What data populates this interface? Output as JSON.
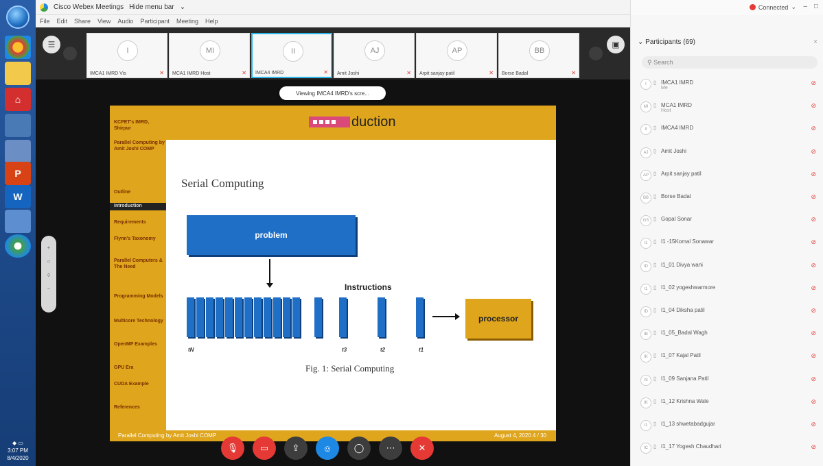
{
  "window": {
    "title": "Cisco Webex Meetings",
    "hide_menu": "Hide menu bar",
    "menu": [
      "File",
      "Edit",
      "Share",
      "View",
      "Audio",
      "Participant",
      "Meeting",
      "Help"
    ]
  },
  "thumbnails": [
    {
      "initials": "I",
      "name": "IMCA1 IMRD Vis"
    },
    {
      "initials": "MI",
      "name": "MCA1 IMRD Host"
    },
    {
      "initials": "II",
      "name": "IMCA4 IMRD"
    },
    {
      "initials": "AJ",
      "name": "Amit Joshi"
    },
    {
      "initials": "AP",
      "name": "Arpit sanjay patil"
    },
    {
      "initials": "BB",
      "name": "Borse Badal"
    }
  ],
  "viewing_banner": "Viewing IMCA4 IMRD's scre...",
  "slide": {
    "title": "duction",
    "side_items": [
      {
        "label": "KCPET's IMRD, Shirpur"
      },
      {
        "label": "Parallel Computing by Amit Joshi COMP"
      },
      {
        "label": "Outline"
      },
      {
        "label": "Introduction"
      },
      {
        "label": "Requirements"
      },
      {
        "label": "Flynn's Taxonomy"
      },
      {
        "label": "Parallel Computers & The Need"
      },
      {
        "label": "Programming Models"
      },
      {
        "label": "Multicore Technology"
      },
      {
        "label": "OpenMP Examples"
      },
      {
        "label": "GPU Era"
      },
      {
        "label": "CUDA Example"
      },
      {
        "label": "References"
      }
    ],
    "heading": "Serial Computing",
    "problem_label": "problem",
    "instructions_label": "Instructions",
    "processor_label": "processor",
    "t_labels": [
      "tN",
      "t3",
      "t2",
      "t1"
    ],
    "caption": "Fig. 1: Serial Computing",
    "footer_left": "Parallel Computing by Amit Joshi COMP",
    "footer_right": "August 4, 2020     4 / 30"
  },
  "controls": [
    {
      "icon": "mic-off-icon",
      "color": "#e53935"
    },
    {
      "icon": "video-off-icon",
      "color": "#e53935"
    },
    {
      "icon": "share-icon",
      "color": "#3d3d3d"
    },
    {
      "icon": "participants-icon",
      "color": "#1e88e5"
    },
    {
      "icon": "chat-icon",
      "color": "#3d3d3d"
    },
    {
      "icon": "more-icon",
      "color": "#3d3d3d"
    },
    {
      "icon": "close-icon",
      "color": "#e53935"
    }
  ],
  "panel": {
    "connection": "Connected",
    "title": "Participants (69)",
    "search_placeholder": "Search",
    "participants": [
      {
        "initials": "I",
        "name": "IMCA1 IMRD",
        "sub": "Me"
      },
      {
        "initials": "MI",
        "name": "MCA1 IMRD",
        "sub": "Host"
      },
      {
        "initials": "II",
        "name": "IMCA4 IMRD",
        "sub": ""
      },
      {
        "initials": "AJ",
        "name": "Amit Joshi",
        "sub": ""
      },
      {
        "initials": "AP",
        "name": "Arpit sanjay patil",
        "sub": ""
      },
      {
        "initials": "BB",
        "name": "Borse Badal",
        "sub": ""
      },
      {
        "initials": "GS",
        "name": "Gopal Sonar",
        "sub": ""
      },
      {
        "initials": "I1",
        "name": "I1 -15Komal Sonawar",
        "sub": ""
      },
      {
        "initials": "ID",
        "name": "I1_01 Divya wani",
        "sub": ""
      },
      {
        "initials": "I1",
        "name": "I1_02 yogeshwarmore",
        "sub": ""
      },
      {
        "initials": "ID",
        "name": "I1_04 Diksha patil",
        "sub": ""
      },
      {
        "initials": "IB",
        "name": "I1_05_Badal Wagh",
        "sub": ""
      },
      {
        "initials": "IK",
        "name": "I1_07 Kajal Patil",
        "sub": ""
      },
      {
        "initials": "IS",
        "name": "I1_09 Sanjana Patil",
        "sub": ""
      },
      {
        "initials": "IK",
        "name": "I1_12 Krishna Wale",
        "sub": ""
      },
      {
        "initials": "I1",
        "name": "I1_13 shwetabadgujar",
        "sub": ""
      },
      {
        "initials": "IC",
        "name": "I1_17 Yogesh Chaudhari",
        "sub": ""
      }
    ]
  },
  "taskbar": {
    "time": "3:07 PM",
    "date": "8/4/2020"
  }
}
